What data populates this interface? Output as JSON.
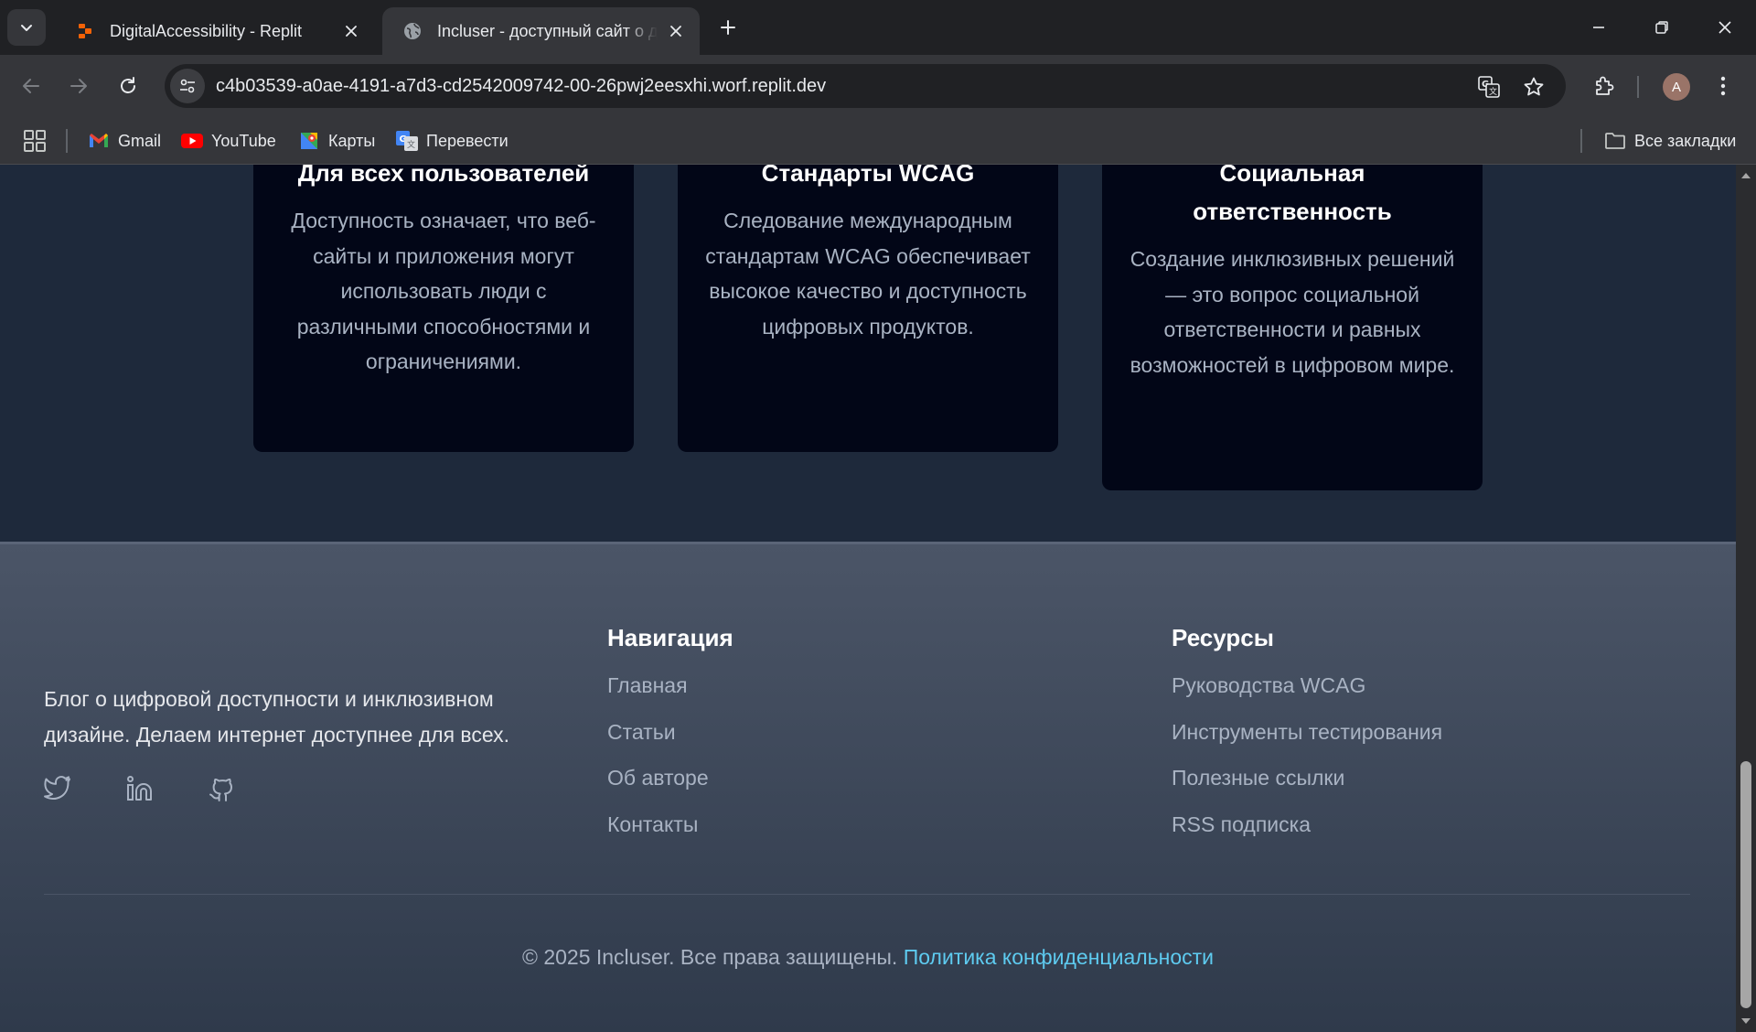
{
  "browser": {
    "tabs": [
      {
        "title": "DigitalAccessibility - Replit",
        "active": false
      },
      {
        "title": "Incluser - доступный сайт о доступности",
        "active": true
      }
    ],
    "url": "c4b03539-a0ae-4191-a7d3-cd2542009742-00-26pwj2eesxhi.worf.replit.dev",
    "profile_initial": "A",
    "bookmarks": [
      {
        "label": "Gmail",
        "icon": "gmail-icon"
      },
      {
        "label": "YouTube",
        "icon": "youtube-icon"
      },
      {
        "label": "Карты",
        "icon": "maps-icon"
      },
      {
        "label": "Перевести",
        "icon": "translate-icon"
      }
    ],
    "all_bookmarks": "Все закладки"
  },
  "features": {
    "cards": [
      {
        "title": "Для всех пользователей",
        "text": "Доступность означает, что веб-сайты и приложения могут использовать люди с различными способностями и ограничениями."
      },
      {
        "title": "Стандарты WCAG",
        "text": "Следование международным стандартам WCAG обеспечивает высокое качество и доступность цифровых продуктов."
      },
      {
        "title": "Социальная ответственность",
        "text": "Создание инклюзивных решений — это вопрос социальной ответственности и равных возможностей в цифровом мире."
      }
    ]
  },
  "footer": {
    "about": "Блог о цифровой доступности и инклюзивном дизайне. Делаем интернет доступнее для всех.",
    "social": [
      "twitter-icon",
      "linkedin-icon",
      "github-icon"
    ],
    "navigation": {
      "title": "Навигация",
      "links": [
        "Главная",
        "Статьи",
        "Об авторе",
        "Контакты"
      ]
    },
    "resources": {
      "title": "Ресурсы",
      "links": [
        "Руководства WCAG",
        "Инструменты тестирования",
        "Полезные ссылки",
        "RSS подписка"
      ]
    },
    "copyright": "© 2025 Incluser. Все права защищены.",
    "privacy_link": "Политика конфиденциальности"
  },
  "colors": {
    "section_bg": "#1e293b",
    "card_bg": "#020617",
    "link_accent": "#5ecbf0"
  }
}
